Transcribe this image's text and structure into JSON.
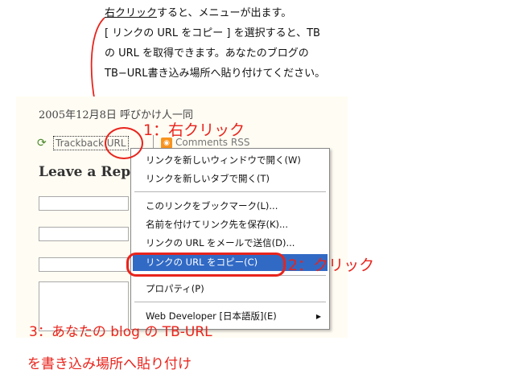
{
  "instructions": {
    "line1_underlined": "右クリック",
    "line1_rest": "すると、メニューが出ます。",
    "line2": "[ リンクの URL をコピー ] を選択すると、TB",
    "line3": "の URL を取得できます。あなたのブログの",
    "line4": "TB−URL書き込み場所へ貼り付けてください。"
  },
  "blog": {
    "date_line": "2005年12月8日  呼びかけ人一同",
    "trackback_label": "Trackback URL",
    "rss_label": "Comments RSS",
    "leave_reply": "Leave a Rep"
  },
  "context_menu": {
    "items": [
      {
        "label": "リンクを新しいウィンドウで開く(W)"
      },
      {
        "label": "リンクを新しいタブで開く(T)"
      },
      {
        "label": "このリンクをブックマーク(L)..."
      },
      {
        "label": "名前を付けてリンク先を保存(K)..."
      },
      {
        "label": "リンクの URL をメールで送信(D)..."
      },
      {
        "label": "リンクの URL をコピー(C)"
      },
      {
        "label": "プロパティ(P)"
      },
      {
        "label": "Web Developer [日本語版](E)"
      }
    ],
    "selected_index": 5
  },
  "annotations": {
    "step1": "1：右クリック",
    "step2": "2：クリック",
    "step3_line1": "3：あなたの blog の TB-URL",
    "step3_line2": "を書き込み場所へ貼り付け"
  },
  "colors": {
    "annotation_red": "#e8241c",
    "menu_highlight": "#316ac5",
    "page_bg": "#fffcf3"
  }
}
